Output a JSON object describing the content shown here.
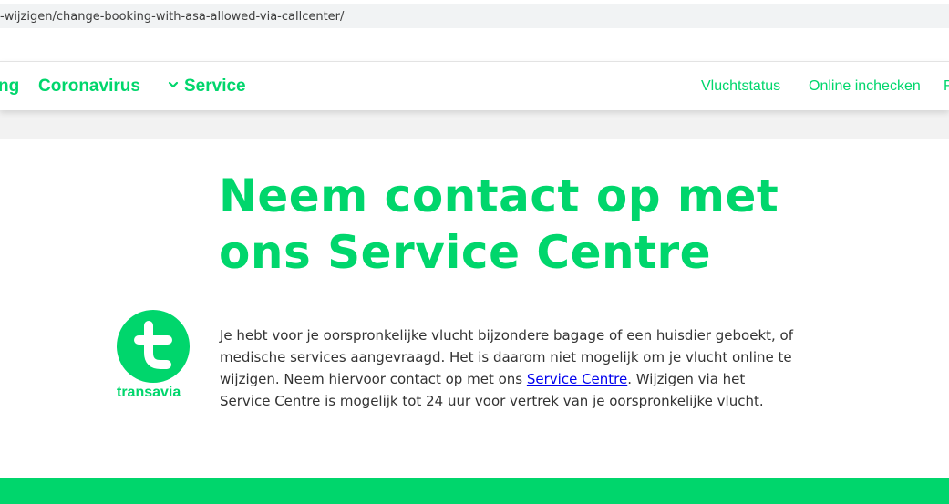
{
  "browser": {
    "url_text": "-wijzigen/change-booking-with-asa-allowed-via-callcenter/"
  },
  "nav": {
    "truncated_item": "ng",
    "coronavirus": "Coronavirus",
    "service": "Service",
    "service_icon": "chevron-down-icon",
    "flight_status": "Vluchtstatus",
    "online_checkin": "Online inchecken",
    "truncated_right": "F"
  },
  "main": {
    "title": "Neem contact op met ons Service Centre",
    "body_part1": "Je hebt voor je oorspronkelijke vlucht bijzondere bagage of een huisdier geboekt, of medische services aangevraagd. Het is daarom niet mogelijk om je vlucht online te wijzigen. Neem hiervoor contact op met ons ",
    "body_link": "Service Centre",
    "body_part2": ". Wijzigen via het Service Centre is mogelijk tot 24 uur voor vertrek van je oorspronkelijke vlucht."
  },
  "logo": {
    "wordmark": "transavia",
    "icon": "transavia-logo-icon"
  },
  "colors": {
    "brand_green": "#00d66c",
    "text": "#333333",
    "link": "#0000ee",
    "band_grey": "#f2f2f2"
  }
}
